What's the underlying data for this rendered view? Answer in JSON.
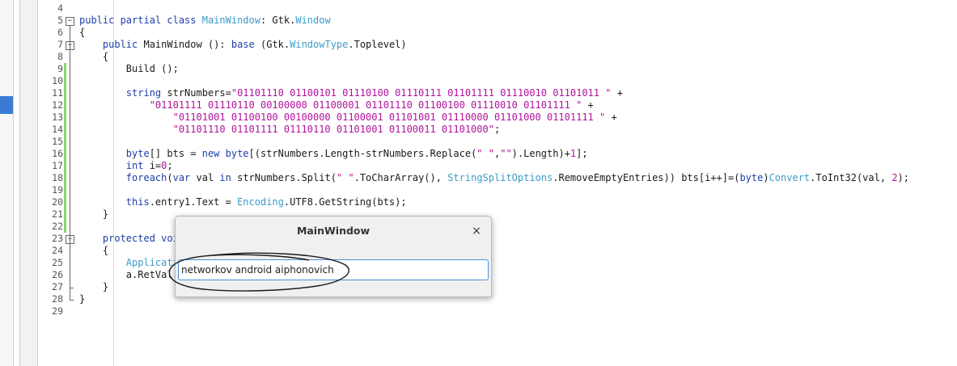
{
  "dialog": {
    "title": "MainWindow",
    "close_glyph": "×",
    "entry_value": "networkov android aiphonovich"
  },
  "lines": [
    {
      "num": "4",
      "segments": [
        {
          "t": "",
          "c": "pl"
        }
      ]
    },
    {
      "num": "5",
      "segments": [
        {
          "t": "public partial class ",
          "c": "kw"
        },
        {
          "t": "MainWindow",
          "c": "ty"
        },
        {
          "t": ": Gtk.",
          "c": "pl"
        },
        {
          "t": "Window",
          "c": "ty"
        }
      ]
    },
    {
      "num": "6",
      "segments": [
        {
          "t": "{",
          "c": "pl"
        }
      ]
    },
    {
      "num": "7",
      "segments": [
        {
          "t": "    public ",
          "c": "kw"
        },
        {
          "t": "MainWindow (): ",
          "c": "pl"
        },
        {
          "t": "base",
          "c": "kw"
        },
        {
          "t": " (Gtk.",
          "c": "pl"
        },
        {
          "t": "WindowType",
          "c": "ty"
        },
        {
          "t": ".Toplevel)",
          "c": "pl"
        }
      ]
    },
    {
      "num": "8",
      "segments": [
        {
          "t": "    {",
          "c": "pl"
        }
      ]
    },
    {
      "num": "9",
      "segments": [
        {
          "t": "        Build ();",
          "c": "pl"
        }
      ]
    },
    {
      "num": "10",
      "segments": [
        {
          "t": "",
          "c": "pl"
        }
      ]
    },
    {
      "num": "11",
      "segments": [
        {
          "t": "        string ",
          "c": "kw"
        },
        {
          "t": "strNumbers=",
          "c": "pl"
        },
        {
          "t": "\"01101110 01100101 01110100 01110111 01101111 01110010 01101011 \"",
          "c": "st"
        },
        {
          "t": " +",
          "c": "pl"
        }
      ]
    },
    {
      "num": "12",
      "segments": [
        {
          "t": "            ",
          "c": "pl"
        },
        {
          "t": "\"01101111 01110110 00100000 01100001 01101110 01100100 01110010 01101111 \"",
          "c": "st"
        },
        {
          "t": " +",
          "c": "pl"
        }
      ]
    },
    {
      "num": "13",
      "segments": [
        {
          "t": "                ",
          "c": "pl"
        },
        {
          "t": "\"01101001 01100100 00100000 01100001 01101001 01110000 01101000 01101111 \"",
          "c": "st"
        },
        {
          "t": " +",
          "c": "pl"
        }
      ]
    },
    {
      "num": "14",
      "segments": [
        {
          "t": "                ",
          "c": "pl"
        },
        {
          "t": "\"01101110 01101111 01110110 01101001 01100011 01101000\"",
          "c": "st"
        },
        {
          "t": ";",
          "c": "pl"
        }
      ]
    },
    {
      "num": "15",
      "segments": [
        {
          "t": "",
          "c": "pl"
        }
      ]
    },
    {
      "num": "16",
      "segments": [
        {
          "t": "        byte",
          "c": "kw"
        },
        {
          "t": "[] bts = ",
          "c": "pl"
        },
        {
          "t": "new byte",
          "c": "kw"
        },
        {
          "t": "[(strNumbers.Length-strNumbers.Replace(",
          "c": "pl"
        },
        {
          "t": "\" \"",
          "c": "st"
        },
        {
          "t": ",",
          "c": "pl"
        },
        {
          "t": "\"\"",
          "c": "st"
        },
        {
          "t": ").Length)+",
          "c": "pl"
        },
        {
          "t": "1",
          "c": "nm"
        },
        {
          "t": "];",
          "c": "pl"
        }
      ]
    },
    {
      "num": "17",
      "segments": [
        {
          "t": "        int ",
          "c": "kw"
        },
        {
          "t": "i=",
          "c": "pl"
        },
        {
          "t": "0",
          "c": "nm"
        },
        {
          "t": ";",
          "c": "pl"
        }
      ]
    },
    {
      "num": "18",
      "segments": [
        {
          "t": "        foreach",
          "c": "kw"
        },
        {
          "t": "(",
          "c": "pl"
        },
        {
          "t": "var",
          "c": "kw"
        },
        {
          "t": " val ",
          "c": "pl"
        },
        {
          "t": "in",
          "c": "kw"
        },
        {
          "t": " strNumbers.Split(",
          "c": "pl"
        },
        {
          "t": "\" \"",
          "c": "st"
        },
        {
          "t": ".ToCharArray(), ",
          "c": "pl"
        },
        {
          "t": "StringSplitOptions",
          "c": "ty"
        },
        {
          "t": ".RemoveEmptyEntries)) bts[i++]=(",
          "c": "pl"
        },
        {
          "t": "byte",
          "c": "kw"
        },
        {
          "t": ")",
          "c": "pl"
        },
        {
          "t": "Convert",
          "c": "ty"
        },
        {
          "t": ".ToInt32(val, ",
          "c": "pl"
        },
        {
          "t": "2",
          "c": "nm"
        },
        {
          "t": ");",
          "c": "pl"
        }
      ]
    },
    {
      "num": "19",
      "segments": [
        {
          "t": "",
          "c": "pl"
        }
      ]
    },
    {
      "num": "20",
      "segments": [
        {
          "t": "        this",
          "c": "kw"
        },
        {
          "t": ".entry1.Text = ",
          "c": "pl"
        },
        {
          "t": "Encoding",
          "c": "ty"
        },
        {
          "t": ".UTF8.GetString(bts);",
          "c": "pl"
        }
      ]
    },
    {
      "num": "21",
      "segments": [
        {
          "t": "    }",
          "c": "pl"
        }
      ]
    },
    {
      "num": "22",
      "segments": [
        {
          "t": "",
          "c": "pl"
        }
      ]
    },
    {
      "num": "23",
      "segments": [
        {
          "t": "    protected voi",
          "c": "kw"
        }
      ]
    },
    {
      "num": "24",
      "segments": [
        {
          "t": "    {",
          "c": "pl"
        }
      ]
    },
    {
      "num": "25",
      "segments": [
        {
          "t": "        Applicati",
          "c": "ty"
        }
      ]
    },
    {
      "num": "26",
      "segments": [
        {
          "t": "        a.RetVal",
          "c": "pl"
        }
      ]
    },
    {
      "num": "27",
      "segments": [
        {
          "t": "    }",
          "c": "pl"
        }
      ]
    },
    {
      "num": "28",
      "segments": [
        {
          "t": "}",
          "c": "pl"
        }
      ]
    },
    {
      "num": "29",
      "segments": [
        {
          "t": "",
          "c": "pl"
        }
      ]
    }
  ],
  "fold_markers": [
    "5",
    "7",
    "23"
  ],
  "changed_lines": [
    "9",
    "10",
    "11",
    "12",
    "13",
    "14",
    "15",
    "16",
    "17",
    "18",
    "19",
    "20",
    "21",
    "22"
  ],
  "colors": {
    "keyword": "#1e3ea8",
    "type": "#3b9cc8",
    "string": "#b0139c",
    "change_marker": "#8bd36b",
    "entry_focus": "#4a90d9"
  },
  "icons": {
    "fold": "minus-box-icon",
    "close": "close-icon"
  }
}
